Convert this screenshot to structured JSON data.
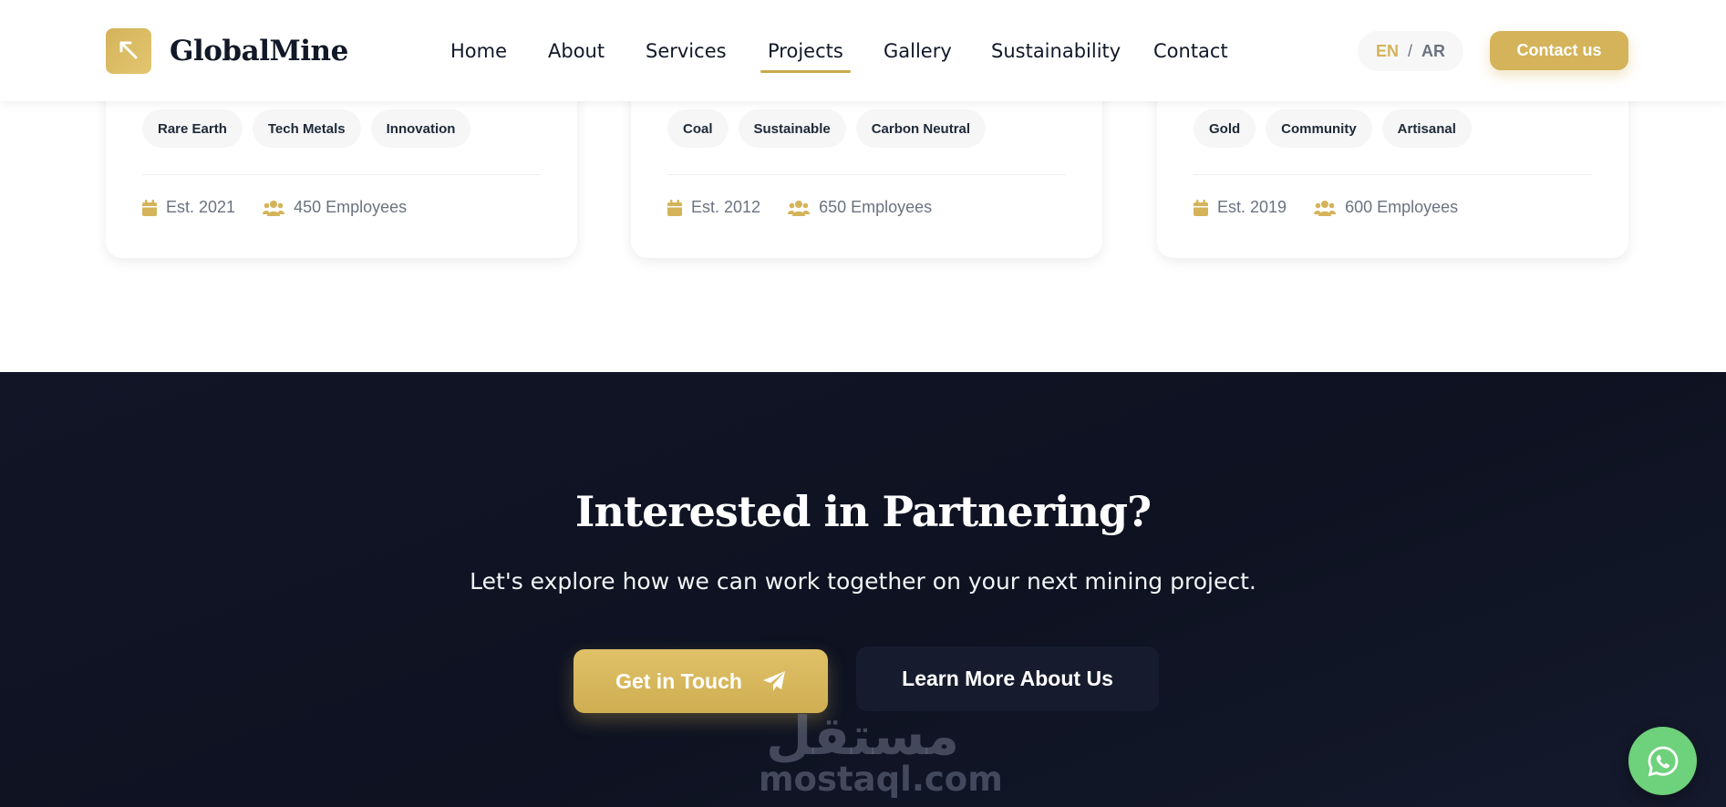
{
  "header": {
    "brand": "GlobalMine",
    "nav": [
      {
        "label": "Home"
      },
      {
        "label": "About"
      },
      {
        "label": "Services"
      },
      {
        "label": "Projects",
        "active": true
      },
      {
        "label": "Gallery"
      },
      {
        "label": "Sustainability"
      },
      {
        "label": "Contact"
      }
    ],
    "lang_en": "EN",
    "lang_sep": "/",
    "lang_ar": "AR",
    "contact_label": "Contact us"
  },
  "cards": [
    {
      "tags": [
        "Rare Earth",
        "Tech Metals",
        "Innovation"
      ],
      "established": "Est. 2021",
      "employees": "450 Employees"
    },
    {
      "tags": [
        "Coal",
        "Sustainable",
        "Carbon Neutral"
      ],
      "established": "Est. 2012",
      "employees": "650 Employees"
    },
    {
      "tags": [
        "Gold",
        "Community",
        "Artisanal"
      ],
      "established": "Est. 2019",
      "employees": "600 Employees"
    }
  ],
  "cta": {
    "title": "Interested in Partnering?",
    "subtitle": "Let's explore how we can work together on your next mining project.",
    "primary_label": "Get in Touch",
    "secondary_label": "Learn More About Us"
  },
  "watermark": {
    "arabic": "مستقل",
    "latin": "mostaql.com"
  },
  "icons": {
    "logo": "pickaxe-icon",
    "established": "calendar-icon",
    "employees": "users-icon",
    "primary": "paper-plane-icon",
    "chat": "whatsapp-icon"
  },
  "colors": {
    "accent": "#d4b35a",
    "dark": "#0e1221",
    "whatsapp": "#6ed17b"
  }
}
